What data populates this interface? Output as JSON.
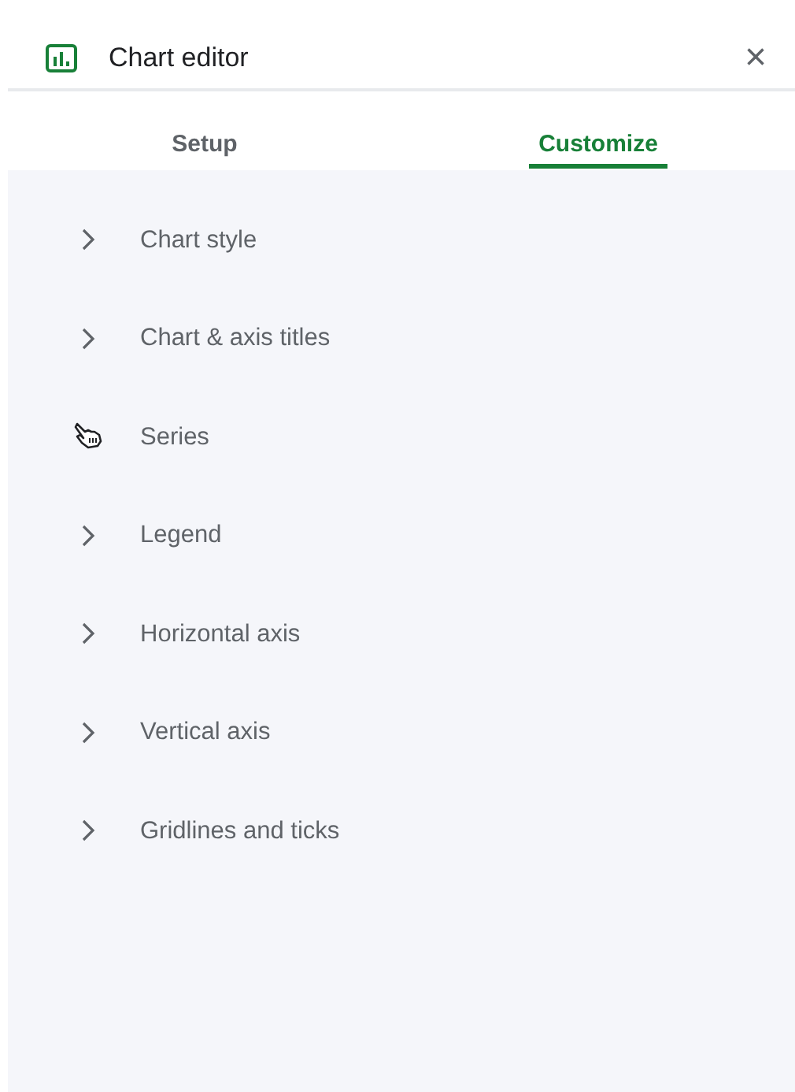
{
  "header": {
    "title": "Chart editor",
    "close": "×"
  },
  "tabs": [
    {
      "label": "Setup",
      "selected": false
    },
    {
      "label": "Customize",
      "selected": true
    }
  ],
  "sections": [
    {
      "label": "Chart style",
      "hovered": false
    },
    {
      "label": "Chart & axis titles",
      "hovered": false
    },
    {
      "label": "Series",
      "hovered": true
    },
    {
      "label": "Legend",
      "hovered": false
    },
    {
      "label": "Horizontal axis",
      "hovered": false
    },
    {
      "label": "Vertical axis",
      "hovered": false
    },
    {
      "label": "Gridlines and ticks",
      "hovered": false
    }
  ]
}
